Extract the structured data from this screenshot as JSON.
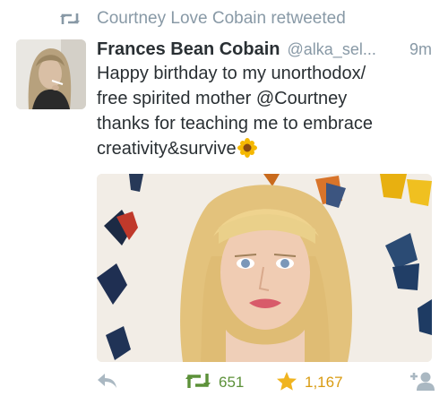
{
  "retweet_context": {
    "icon": "retweet-icon",
    "text": "Courtney Love Cobain retweeted"
  },
  "tweet": {
    "author": {
      "display_name": "Frances Bean Cobain",
      "handle": "@alka_sel...",
      "avatar_icon": "avatar-photo"
    },
    "timestamp": "9m",
    "text_lines": [
      "Happy birthday to my unorthodox/",
      "free spirited mother @Courtney",
      "thanks for teaching me to embrace",
      "creativity&survive"
    ],
    "emoji": "sunflower-icon",
    "media": {
      "description_icon": "photo-image"
    }
  },
  "actions": {
    "reply_icon": "reply-icon",
    "retweet_icon": "retweet-icon",
    "retweet_count": "651",
    "favorite_icon": "star-icon",
    "favorite_count": "1,167",
    "follow_icon": "follow-user-icon"
  },
  "colors": {
    "text_primary": "#292f33",
    "text_secondary": "#8899a6",
    "retweet_green": "#5c9139",
    "favorite_gold": "#f0b420",
    "icon_gray": "#aab8c2"
  }
}
